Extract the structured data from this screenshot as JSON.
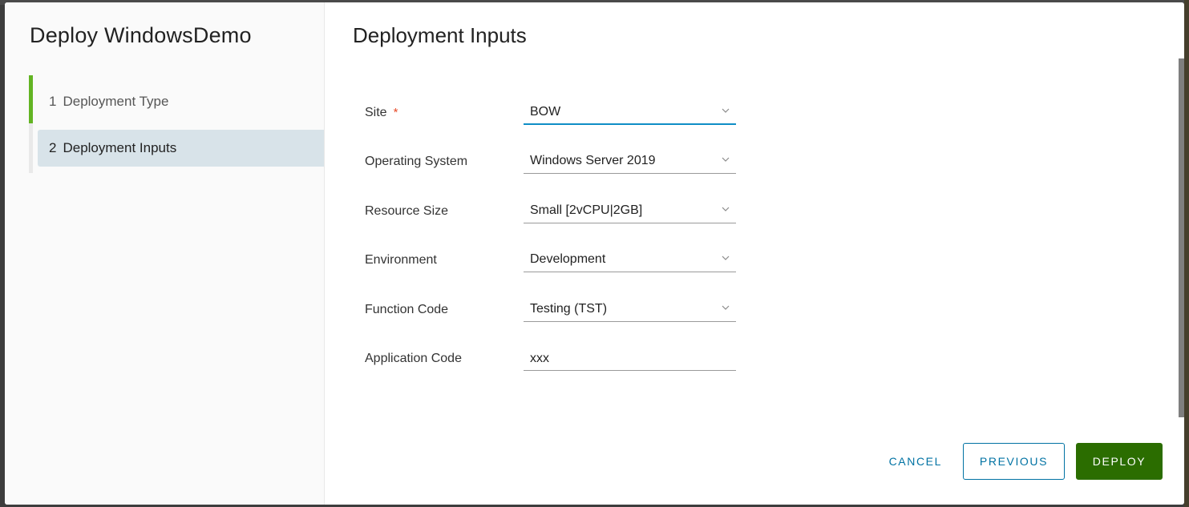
{
  "modal": {
    "title": "Deploy WindowsDemo",
    "steps": [
      {
        "number": "1",
        "label": "Deployment Type",
        "state": "completed"
      },
      {
        "number": "2",
        "label": "Deployment Inputs",
        "state": "active"
      }
    ]
  },
  "main": {
    "title": "Deployment Inputs",
    "fields": [
      {
        "label": "Site",
        "required": true,
        "required_marker": "*",
        "type": "select",
        "value": "BOW",
        "focused": true
      },
      {
        "label": "Operating System",
        "required": false,
        "type": "select",
        "value": "Windows Server 2019"
      },
      {
        "label": "Resource Size",
        "required": false,
        "type": "select",
        "value": "Small [2vCPU|2GB]"
      },
      {
        "label": "Environment",
        "required": false,
        "type": "select",
        "value": "Development"
      },
      {
        "label": "Function Code",
        "required": false,
        "type": "select",
        "value": "Testing (TST)"
      },
      {
        "label": "Application Code",
        "required": false,
        "type": "text",
        "value": "xxx"
      }
    ]
  },
  "footer": {
    "cancel_label": "CANCEL",
    "previous_label": "PREVIOUS",
    "deploy_label": "DEPLOY"
  },
  "colors": {
    "accent": "#0072a3",
    "focus": "#0f8ec6",
    "primary_button": "#2b6d00",
    "step_progress": "#62b422",
    "active_step_bg": "#d8e3e9",
    "required": "#e74c2b"
  }
}
